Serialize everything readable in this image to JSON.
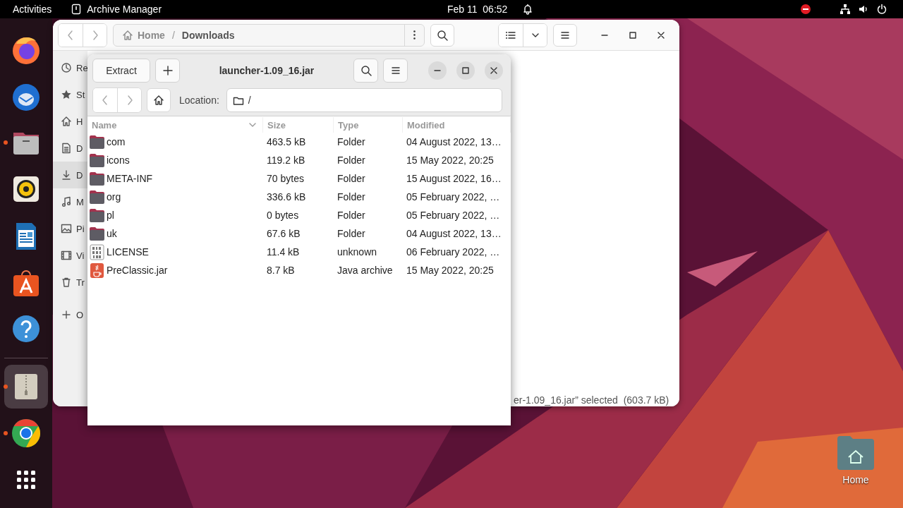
{
  "top_bar": {
    "activities": "Activities",
    "app_name": "Archive Manager",
    "clock": "Feb 11  06:52"
  },
  "dock": {
    "items": [
      {
        "kind": "firefox",
        "running": false,
        "selected": false
      },
      {
        "kind": "thunderbird",
        "running": false,
        "selected": false
      },
      {
        "kind": "files",
        "running": true,
        "selected": false
      },
      {
        "kind": "rhythmbox",
        "running": false,
        "selected": false
      },
      {
        "kind": "writer",
        "running": false,
        "selected": false
      },
      {
        "kind": "software",
        "running": false,
        "selected": false
      },
      {
        "kind": "help",
        "running": false,
        "selected": false
      },
      {
        "kind": "separator"
      },
      {
        "kind": "archive",
        "running": true,
        "selected": true
      },
      {
        "kind": "chrome",
        "running": true,
        "selected": false
      },
      {
        "kind": "apps",
        "running": false,
        "selected": false
      }
    ]
  },
  "desktop": {
    "icons": [
      {
        "label": "Home"
      }
    ]
  },
  "files_window": {
    "path": [
      {
        "label": "Home"
      },
      {
        "label": "Downloads"
      }
    ],
    "path_separator": "/",
    "sidebar": [
      {
        "kind": "recent",
        "label": "Re",
        "selected": false
      },
      {
        "kind": "starred",
        "label": "St",
        "selected": false
      },
      {
        "kind": "home",
        "label": "H",
        "selected": false
      },
      {
        "kind": "documents",
        "label": "D",
        "selected": false
      },
      {
        "kind": "downloads",
        "label": "D",
        "selected": true
      },
      {
        "kind": "music",
        "label": "M",
        "selected": false
      },
      {
        "kind": "pictures",
        "label": "Pi",
        "selected": false
      },
      {
        "kind": "videos",
        "label": "Vi",
        "selected": false
      },
      {
        "kind": "trash",
        "label": "Tr",
        "selected": false
      },
      {
        "kind": "other",
        "label": "O",
        "selected": false
      }
    ],
    "status": "er-1.09_16.jar” selected  (603.7 kB)"
  },
  "archive_window": {
    "title": "launcher-1.09_16.jar",
    "extract": "Extract",
    "location_label": "Location:",
    "location": "/",
    "columns": [
      {
        "label": "Name",
        "sorted": true
      },
      {
        "label": "Size",
        "sorted": false
      },
      {
        "label": "Type",
        "sorted": false
      },
      {
        "label": "Modified",
        "sorted": false
      }
    ],
    "rows": [
      {
        "kind": "folder",
        "name": "com",
        "size": "463.5 kB",
        "type": "Folder",
        "modified": "04 August 2022, 13…"
      },
      {
        "kind": "folder",
        "name": "icons",
        "size": "119.2 kB",
        "type": "Folder",
        "modified": "15 May 2022, 20:25"
      },
      {
        "kind": "folder",
        "name": "META-INF",
        "size": "70 bytes",
        "type": "Folder",
        "modified": "15 August 2022, 16…"
      },
      {
        "kind": "folder",
        "name": "org",
        "size": "336.6 kB",
        "type": "Folder",
        "modified": "05 February 2022, …"
      },
      {
        "kind": "folder",
        "name": "pl",
        "size": "0 bytes",
        "type": "Folder",
        "modified": "05 February 2022, …"
      },
      {
        "kind": "folder",
        "name": "uk",
        "size": "67.6 kB",
        "type": "Folder",
        "modified": "04 August 2022, 13…"
      },
      {
        "kind": "binary",
        "name": "LICENSE",
        "size": "11.4 kB",
        "type": "unknown",
        "modified": "06 February 2022, …"
      },
      {
        "kind": "jar",
        "name": "PreClassic.jar",
        "size": "8.7 kB",
        "type": "Java archive",
        "modified": "15 May 2022, 20:25"
      }
    ]
  }
}
